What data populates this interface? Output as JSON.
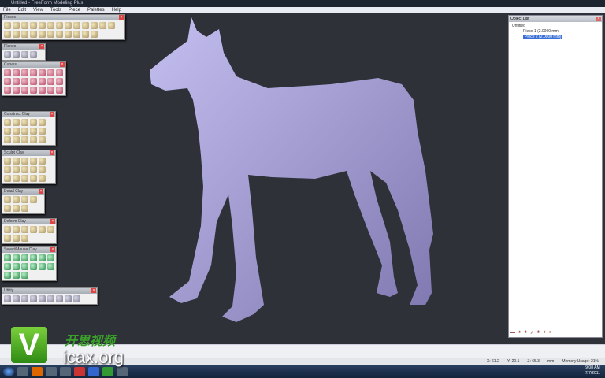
{
  "window": {
    "title": "Untitled - FreeForm Modeling Plus"
  },
  "menu": [
    "File",
    "Edit",
    "View",
    "Tools",
    "Piece",
    "Palettes",
    "Help"
  ],
  "palettes": [
    {
      "title": "Pieces",
      "icons": 24,
      "style": "tan"
    },
    {
      "title": "Planes",
      "icons": 4,
      "style": "gray"
    },
    {
      "title": "Curves",
      "icons": 21,
      "style": "red"
    },
    {
      "title": "Construct Clay",
      "icons": 15,
      "style": "tan"
    },
    {
      "title": "Sculpt Clay",
      "icons": 15,
      "style": "tan"
    },
    {
      "title": "Detail Clay",
      "icons": 7,
      "style": "tan"
    },
    {
      "title": "Deform Clay",
      "icons": 9,
      "style": "tan"
    },
    {
      "title": "Select/Mouse Clay",
      "icons": 15,
      "style": "green"
    },
    {
      "title": "Utility",
      "icons": 9,
      "style": "gray"
    }
  ],
  "object_list": {
    "title": "Object List",
    "root": "Untitled",
    "items": [
      {
        "label": "Piece 1 (2.0000 mm)",
        "selected": false
      },
      {
        "label": "Piece 2 (2.0000 mm)",
        "selected": true
      }
    ]
  },
  "status": {
    "x": "X: 61.2",
    "y": "Y: 20.1",
    "z": "Z: 65.3",
    "units": "mm",
    "memory": "Memory Usage: 21%"
  },
  "clock": {
    "time": "9:08 AM",
    "date": "7/7/2011"
  },
  "watermark": {
    "letter": "V",
    "cn": "开思视频",
    "en": "icax.org"
  },
  "colors": {
    "clay": "#a9a3d6",
    "viewport": "#2e3138",
    "selection": "#3a6fd8"
  }
}
